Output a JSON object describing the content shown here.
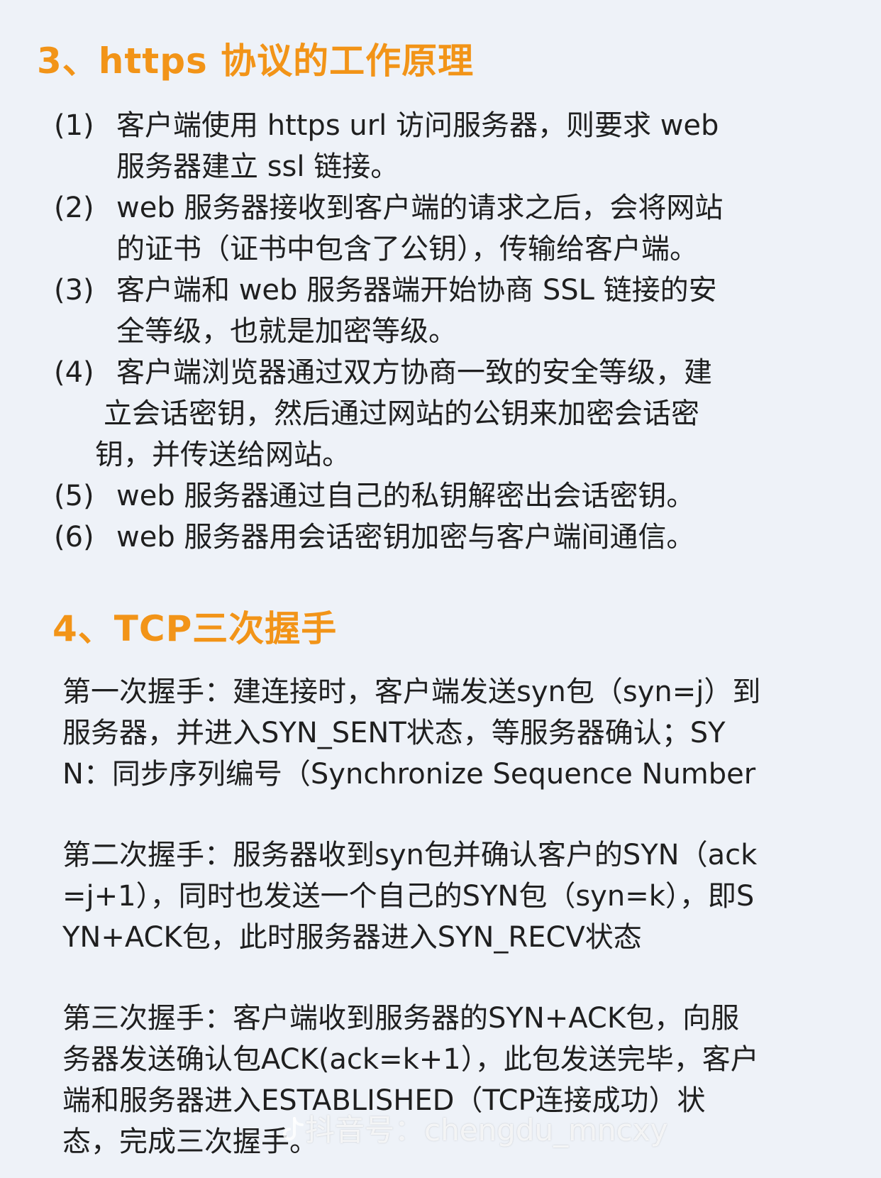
{
  "section3": {
    "title": "3、https 协议的工作原理",
    "steps": [
      {
        "num": "(1)",
        "lines": [
          "客户端使用 https url 访问服务器，则要求 web",
          "服务器建立 ssl 链接。"
        ]
      },
      {
        "num": "(2)",
        "lines": [
          "web 服务器接收到客户端的请求之后，会将网站",
          "的证书（证书中包含了公钥），传输给客户端。"
        ]
      },
      {
        "num": "(3)",
        "lines": [
          "客户端和 web 服务器端开始协商 SSL 链接的安",
          "全等级，也就是加密等级。"
        ]
      },
      {
        "num": "(4)",
        "lines": [
          "客户端浏览器通过双方协商一致的安全等级，建",
          "立会话密钥，然后通过网站的公钥来加密会话密",
          "钥，并传送给网站。"
        ]
      },
      {
        "num": "(5)",
        "lines": [
          "web 服务器通过自己的私钥解密出会话密钥。"
        ]
      },
      {
        "num": "(6)",
        "lines": [
          "web 服务器用会话密钥加密与客户端间通信。"
        ]
      }
    ]
  },
  "section4": {
    "title": "4、TCP三次握手",
    "paragraphs": [
      [
        "第一次握手：建连接时，客户端发送syn包（syn=j）到",
        "服务器，并进入SYN_SENT状态，等服务器确认；SY",
        "N：同步序列编号（Synchronize Sequence Number"
      ],
      [
        "第二次握手：服务器收到syn包并确认客户的SYN（ack",
        "=j+1），同时也发送一个自己的SYN包（syn=k），即S",
        "YN+ACK包，此时服务器进入SYN_RECV状态"
      ],
      [
        "第三次握手：客户端收到服务器的SYN+ACK包，向服",
        "务器发送确认包ACK(ack=k+1），此包发送完毕，客户",
        "端和服务器进入ESTABLISHED（TCP连接成功）状",
        "态，完成三次握手。"
      ]
    ]
  },
  "watermark": {
    "text": "抖音号：chengdu_mncxy",
    "icon": "douyin-logo-icon"
  },
  "colors": {
    "heading": "#f29418",
    "background": "#eef2f8",
    "body_text": "#1f1f1f"
  }
}
